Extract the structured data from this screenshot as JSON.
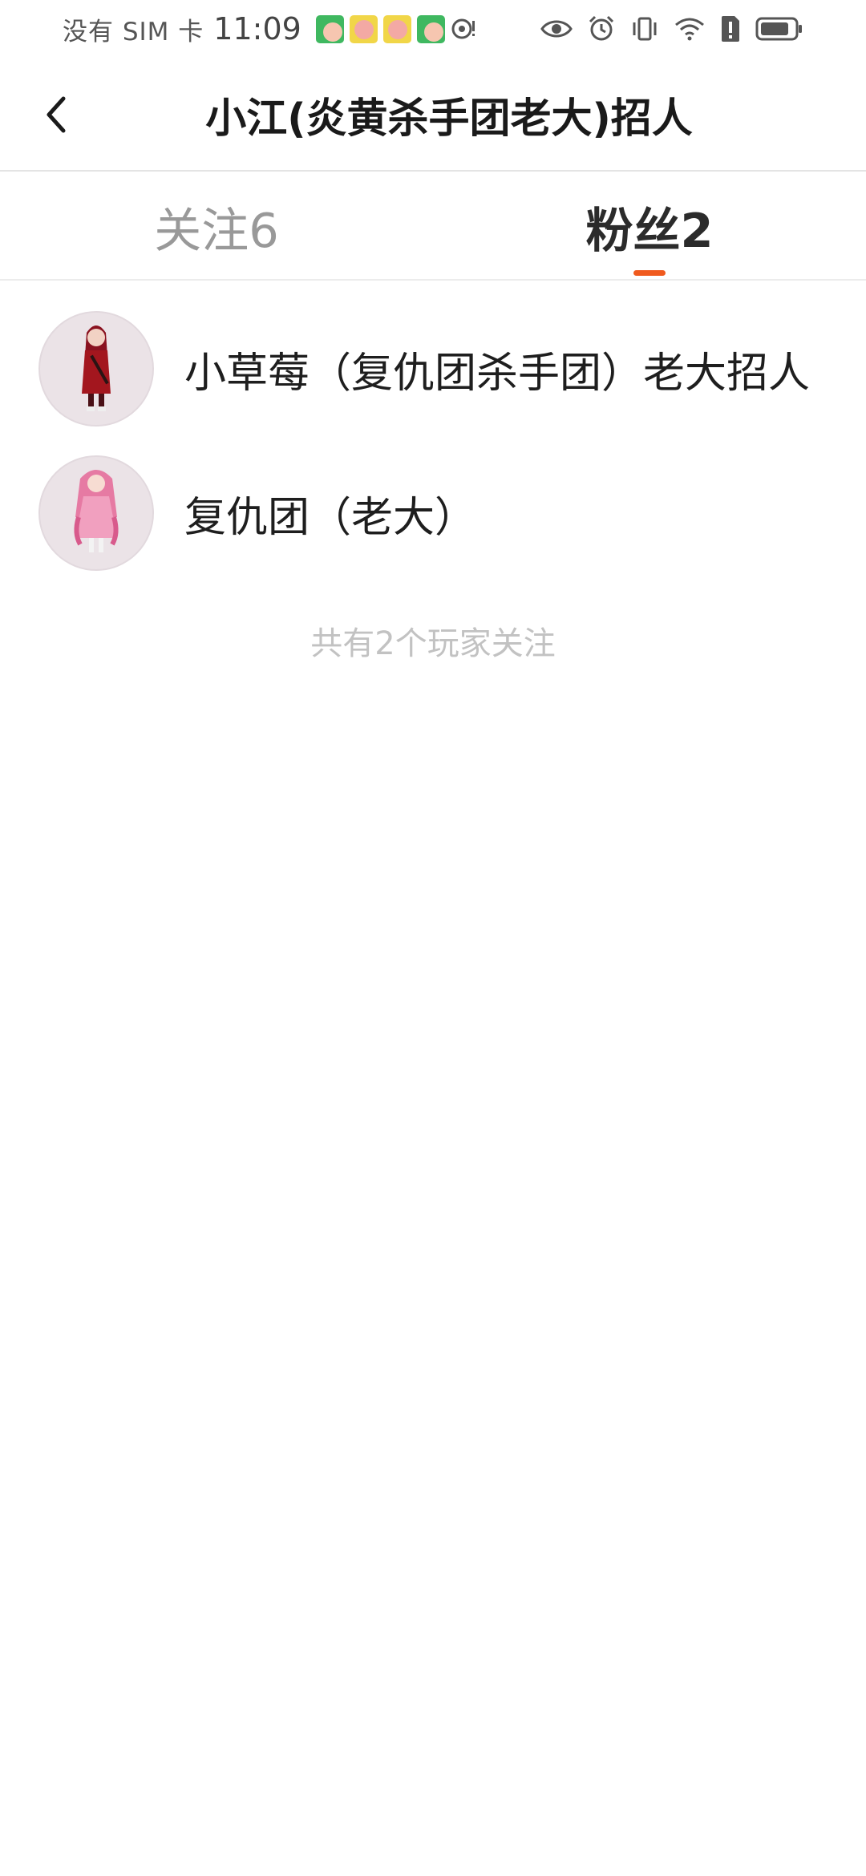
{
  "status_bar": {
    "carrier": "没有 SIM 卡",
    "time": "11:09",
    "notification_icons": [
      "app-icon",
      "app-icon",
      "app-icon",
      "app-icon",
      "hotspot-icon"
    ],
    "system_icons": [
      "eye-icon",
      "alarm-icon",
      "vibrate-icon",
      "wifi-icon",
      "sim-alert-icon",
      "battery-icon"
    ]
  },
  "header": {
    "title": "小江(炎黄杀手团老大)招人"
  },
  "tabs": [
    {
      "label": "关注6",
      "active": false
    },
    {
      "label": "粉丝2",
      "active": true
    }
  ],
  "followers": [
    {
      "name": "小草莓（复仇团杀手团）老大招人"
    },
    {
      "name": "复仇团（老大）"
    }
  ],
  "footer_note": "共有2个玩家关注",
  "colors": {
    "accent": "#f05a1e",
    "text_primary": "#1e1e1e",
    "text_muted": "#999999",
    "avatar_bg": "#ebe3e7"
  }
}
